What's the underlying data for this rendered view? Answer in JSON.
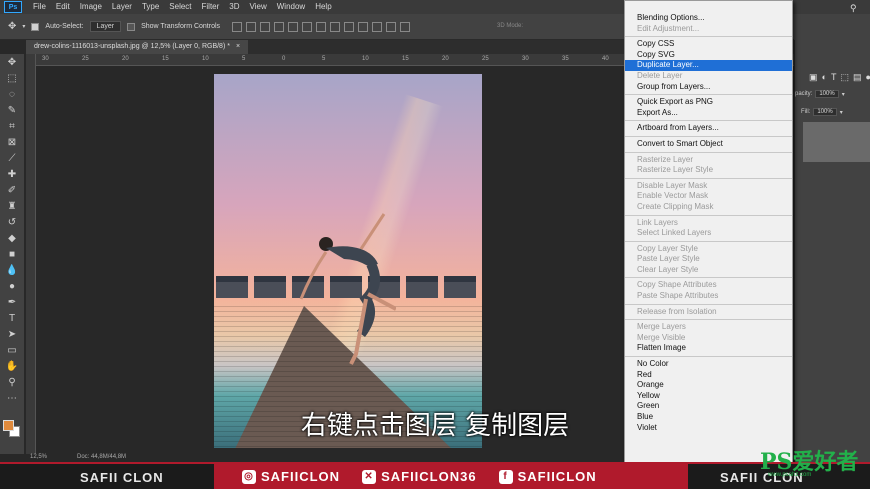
{
  "app": {
    "logo": "Ps",
    "menu": [
      "File",
      "Edit",
      "Image",
      "Layer",
      "Type",
      "Select",
      "Filter",
      "3D",
      "View",
      "Window",
      "Help"
    ]
  },
  "options_bar": {
    "auto_select_label": "Auto-Select:",
    "auto_select_value": "Layer",
    "transform_label": "Show Transform Controls",
    "mode_3d": "3D Mode:"
  },
  "document": {
    "tab_title": "drew-colins-1116013-unsplash.jpg @ 12,5% (Layer 0, RGB/8) *",
    "tab_close": "×",
    "ruler_numbers": [
      "30",
      "25",
      "20",
      "15",
      "10",
      "5",
      "0",
      "5",
      "10",
      "15",
      "20",
      "25",
      "30",
      "35",
      "40",
      "45",
      "50",
      "55",
      "60"
    ]
  },
  "status": {
    "zoom": "12,5%",
    "doc_size": "Doc: 44,8M/44,8M"
  },
  "subtitle": "右键点击图层 复制图层",
  "right_panel": {
    "opacity_label": "pacity:",
    "opacity_value": "100%",
    "fill_label": "Fill:",
    "fill_value": "100%"
  },
  "context_menu": {
    "groups": [
      [
        {
          "label": "Blending Options...",
          "enabled": true
        },
        {
          "label": "Edit Adjustment...",
          "enabled": false
        }
      ],
      [
        {
          "label": "Copy CSS",
          "enabled": true
        },
        {
          "label": "Copy SVG",
          "enabled": true
        },
        {
          "label": "Duplicate Layer...",
          "enabled": true,
          "highlight": true
        },
        {
          "label": "Delete Layer",
          "enabled": false
        },
        {
          "label": "Group from Layers...",
          "enabled": true
        }
      ],
      [
        {
          "label": "Quick Export as PNG",
          "enabled": true
        },
        {
          "label": "Export As...",
          "enabled": true
        }
      ],
      [
        {
          "label": "Artboard from Layers...",
          "enabled": true
        }
      ],
      [
        {
          "label": "Convert to Smart Object",
          "enabled": true
        }
      ],
      [
        {
          "label": "Rasterize Layer",
          "enabled": false
        },
        {
          "label": "Rasterize Layer Style",
          "enabled": false
        }
      ],
      [
        {
          "label": "Disable Layer Mask",
          "enabled": false
        },
        {
          "label": "Enable Vector Mask",
          "enabled": false
        },
        {
          "label": "Create Clipping Mask",
          "enabled": false
        }
      ],
      [
        {
          "label": "Link Layers",
          "enabled": false
        },
        {
          "label": "Select Linked Layers",
          "enabled": false
        }
      ],
      [
        {
          "label": "Copy Layer Style",
          "enabled": false
        },
        {
          "label": "Paste Layer Style",
          "enabled": false
        },
        {
          "label": "Clear Layer Style",
          "enabled": false
        }
      ],
      [
        {
          "label": "Copy Shape Attributes",
          "enabled": false
        },
        {
          "label": "Paste Shape Attributes",
          "enabled": false
        }
      ],
      [
        {
          "label": "Release from Isolation",
          "enabled": false
        }
      ],
      [
        {
          "label": "Merge Layers",
          "enabled": false
        },
        {
          "label": "Merge Visible",
          "enabled": false
        },
        {
          "label": "Flatten Image",
          "enabled": true
        }
      ],
      [
        {
          "label": "No Color",
          "enabled": true
        },
        {
          "label": "Red",
          "enabled": true
        },
        {
          "label": "Orange",
          "enabled": true
        },
        {
          "label": "Yellow",
          "enabled": true
        },
        {
          "label": "Green",
          "enabled": true
        },
        {
          "label": "Blue",
          "enabled": true
        },
        {
          "label": "Violet",
          "enabled": true
        }
      ]
    ]
  },
  "banner": {
    "left_name": "SAFII CLON",
    "handles": [
      {
        "icon": "instagram-icon",
        "glyph": "◎",
        "text": "SAFIICLON"
      },
      {
        "icon": "xbox-icon",
        "glyph": "✕",
        "text": "SAFIICLON36"
      },
      {
        "icon": "facebook-icon",
        "glyph": "f",
        "text": "SAFIICLON"
      }
    ],
    "right_name": "SAFII CLON",
    "accent": "#b01a2c"
  },
  "watermark": {
    "main": "PS爱好者",
    "sub": "www.psahz.com"
  }
}
